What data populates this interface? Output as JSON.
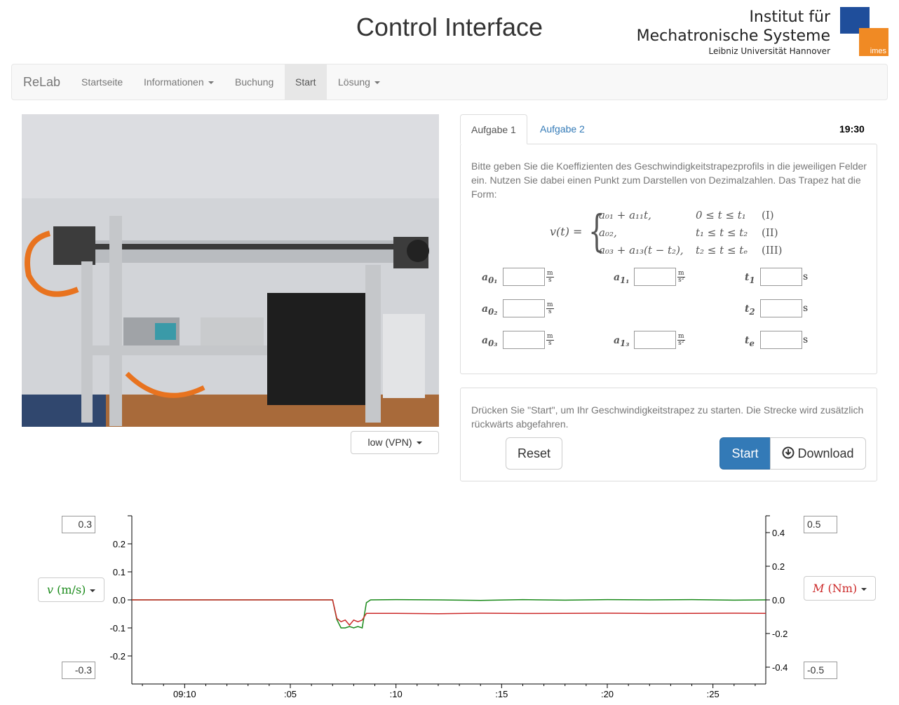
{
  "header": {
    "title": "Control Interface",
    "logo": {
      "line1": "Institut für",
      "line2": "Mechatronische Systeme",
      "line3": "Leibniz Universität Hannover",
      "mark": "imes",
      "colors": {
        "blue": "#1f4e9b",
        "orange": "#f08a24"
      }
    }
  },
  "nav": {
    "brand": "ReLab",
    "items": [
      {
        "label": "Startseite",
        "dropdown": false,
        "active": false
      },
      {
        "label": "Informationen",
        "dropdown": true,
        "active": false
      },
      {
        "label": "Buchung",
        "dropdown": false,
        "active": false
      },
      {
        "label": "Start",
        "dropdown": false,
        "active": true
      },
      {
        "label": "Lösung",
        "dropdown": true,
        "active": false
      }
    ]
  },
  "camera": {
    "quality_label": "low (VPN)"
  },
  "tabs": {
    "items": [
      "Aufgabe 1",
      "Aufgabe 2"
    ],
    "active": "Aufgabe 1",
    "timer": "19:30"
  },
  "task": {
    "instructions": "Bitte geben Sie die Koeffizienten des Geschwindigkeitstrapezprofils in die jeweiligen Felder ein. Nutzen Sie dabei einen Punkt zum Darstellen von Dezimalzahlen. Das Trapez hat die Form:",
    "formula": {
      "lhs": "v(t) =",
      "rows": [
        {
          "expr": "a₀₁ + a₁₁t,",
          "cond": "0 ≤ t ≤ t₁",
          "tag": "(I)"
        },
        {
          "expr": "a₀₂,",
          "cond": "t₁ ≤ t ≤ t₂",
          "tag": "(II)"
        },
        {
          "expr": "a₀₃ + a₁₃(t − t₂),",
          "cond": "t₂ ≤ t ≤ tₑ",
          "tag": "(III)"
        }
      ]
    },
    "fields": {
      "a01": {
        "label": "a",
        "sub": "0₁",
        "value": "",
        "unit_num": "m",
        "unit_den": "s"
      },
      "a02": {
        "label": "a",
        "sub": "0₂",
        "value": "",
        "unit_num": "m",
        "unit_den": "s"
      },
      "a03": {
        "label": "a",
        "sub": "0₃",
        "value": "",
        "unit_num": "m",
        "unit_den": "s"
      },
      "a11": {
        "label": "a",
        "sub": "1₁",
        "value": "",
        "unit_num": "m",
        "unit_den": "s²"
      },
      "a13": {
        "label": "a",
        "sub": "1₃",
        "value": "",
        "unit_num": "m",
        "unit_den": "s²"
      },
      "t1": {
        "label": "t",
        "sub": "1",
        "value": "",
        "unit": "s"
      },
      "t2": {
        "label": "t",
        "sub": "2",
        "value": "",
        "unit": "s"
      },
      "te": {
        "label": "t",
        "sub": "e",
        "value": "",
        "unit": "s"
      }
    }
  },
  "run": {
    "instructions": "Drücken Sie \"Start\", um Ihr Geschwindigkeitstrapez zu starten. Die Strecke wird zusätzlich rückwärts abgefahren.",
    "reset_label": "Reset",
    "start_label": "Start",
    "download_label": "Download"
  },
  "plot_controls": {
    "left_max": "0.3",
    "left_min": "-0.3",
    "right_max": "0.5",
    "right_min": "-0.5",
    "left_select": {
      "symbol": "v",
      "unit": "(m/s)"
    },
    "right_select": {
      "symbol": "M",
      "unit": "(Nm)"
    }
  },
  "chart_data": {
    "type": "line",
    "x_ticks": [
      "09:10",
      ":05",
      ":10",
      ":15",
      ":20",
      ":25"
    ],
    "x_tick_seconds": [
      0,
      5,
      10,
      15,
      20,
      25
    ],
    "xlim": [
      -2.5,
      27.5
    ],
    "y_left": {
      "ticks": [
        0.2,
        0.1,
        0.0,
        -0.1,
        -0.2
      ],
      "labels": [
        "0.2",
        "0.1",
        "0.0",
        "-0.1",
        "-0.2"
      ],
      "ylim": [
        -0.3,
        0.3
      ]
    },
    "y_right": {
      "ticks": [
        0.4,
        0.2,
        0.0,
        -0.2,
        -0.4
      ],
      "labels": [
        "0.4",
        "0.2",
        "0.0",
        "-0.2",
        "-0.4"
      ],
      "ylim": [
        -0.5,
        0.5
      ]
    },
    "series": [
      {
        "axis": "left",
        "color": "#1a8a1a",
        "x": [
          -2.5,
          7.0,
          7.2,
          7.4,
          7.6,
          7.8,
          8.0,
          8.2,
          8.4,
          8.6,
          8.8,
          10,
          12,
          14,
          16,
          18,
          20,
          22,
          24,
          26,
          27.5
        ],
        "y": [
          0,
          0,
          -0.07,
          -0.1,
          -0.1,
          -0.095,
          -0.1,
          -0.095,
          -0.1,
          -0.01,
          0,
          0.001,
          0,
          -0.002,
          0.001,
          -0.001,
          0.001,
          0,
          0.001,
          -0.001,
          0
        ]
      },
      {
        "axis": "right",
        "color": "#cc2a2a",
        "x": [
          -2.5,
          7.0,
          7.2,
          7.4,
          7.6,
          7.8,
          8.0,
          8.2,
          8.4,
          8.6,
          8.8,
          10,
          12,
          14,
          16,
          18,
          20,
          22,
          24,
          26,
          27.5
        ],
        "y": [
          0,
          0,
          -0.11,
          -0.13,
          -0.12,
          -0.15,
          -0.12,
          -0.13,
          -0.12,
          -0.08,
          -0.08,
          -0.08,
          -0.082,
          -0.079,
          -0.081,
          -0.08,
          -0.079,
          -0.081,
          -0.08,
          -0.079,
          -0.08
        ]
      }
    ]
  }
}
